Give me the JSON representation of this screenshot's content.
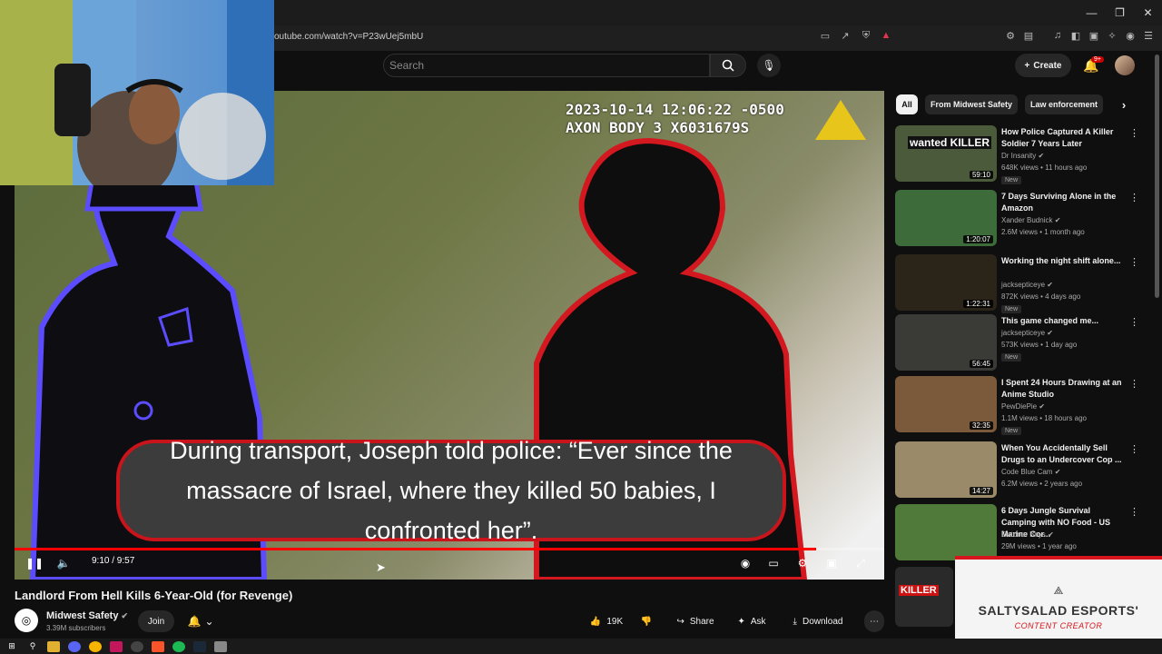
{
  "browser": {
    "url": "outube.com/watch?v=P23wUej5mbU",
    "window_controls": [
      "—",
      "❐",
      "✕"
    ]
  },
  "header": {
    "search_placeholder": "Search",
    "create_label": "Create",
    "notification_count": "9+"
  },
  "video": {
    "timestamp_line1": "2023-10-14 12:06:22 -0500",
    "timestamp_line2": "AXON BODY 3 X6031679S",
    "caption": "During transport, Joseph told police: “Ever since the massacre of Israel, where they killed 50 babies, I confronted her”.",
    "time_display": "9:10 / 9:57",
    "progress": 0.922
  },
  "watch": {
    "title": "Landlord From Hell Kills 6-Year-Old (for Revenge)",
    "channel_name": "Midwest Safety",
    "subscribers": "3.39M subscribers",
    "join_label": "Join",
    "like_count": "19K",
    "share_label": "Share",
    "ask_label": "Ask",
    "download_label": "Download"
  },
  "chips": [
    "All",
    "From Midwest Safety",
    "Law enforcement"
  ],
  "recommendations": [
    {
      "title": "How Police Captured A Killer Soldier 7 Years Later",
      "channel": "Dr Insanity",
      "meta": "648K views • 11 hours ago",
      "badge": "New",
      "duration": "59:10",
      "thumb_text": "wanted KILLER",
      "color": "#4a5a3a"
    },
    {
      "title": "7 Days Surviving Alone in the Amazon",
      "channel": "Xander Budnick",
      "meta": "2.6M views • 1 month ago",
      "badge": "",
      "duration": "1:20:07",
      "thumb_text": "",
      "color": "#3d6b3a"
    },
    {
      "title": "Working the night shift alone...",
      "channel": "jacksepticeye",
      "meta": "872K views • 4 days ago",
      "badge": "New",
      "duration": "1:22:31",
      "thumb_text": "",
      "color": "#2b2418"
    },
    {
      "title": "This game changed me...",
      "channel": "jacksepticeye",
      "meta": "573K views • 1 day ago",
      "badge": "New",
      "duration": "56:45",
      "thumb_text": "",
      "color": "#3a3a36"
    },
    {
      "title": "I Spent 24 Hours Drawing at an Anime Studio",
      "channel": "PewDiePie",
      "meta": "1.1M views • 18 hours ago",
      "badge": "New",
      "duration": "32:35",
      "thumb_text": "",
      "color": "#7a5a3a"
    },
    {
      "title": "When You Accidentally Sell Drugs to an Undercover Cop ...",
      "channel": "Code Blue Cam",
      "meta": "6.2M views • 2 years ago",
      "badge": "",
      "duration": "14:27",
      "thumb_text": "",
      "color": "#9a8a6a"
    },
    {
      "title": "6 Days Jungle Survival Camping with NO Food - US Marine Cor...",
      "channel": "Outdoor Boys",
      "meta": "29M views • 1 year ago",
      "badge": "",
      "duration": "",
      "thumb_text": "",
      "color": "#4f7a3a"
    }
  ],
  "partial_thumb_text": "KILLER",
  "brand_overlay": {
    "name": "SALTYSALAD ESPORTS'",
    "subtitle": "CONTENT CREATOR"
  }
}
